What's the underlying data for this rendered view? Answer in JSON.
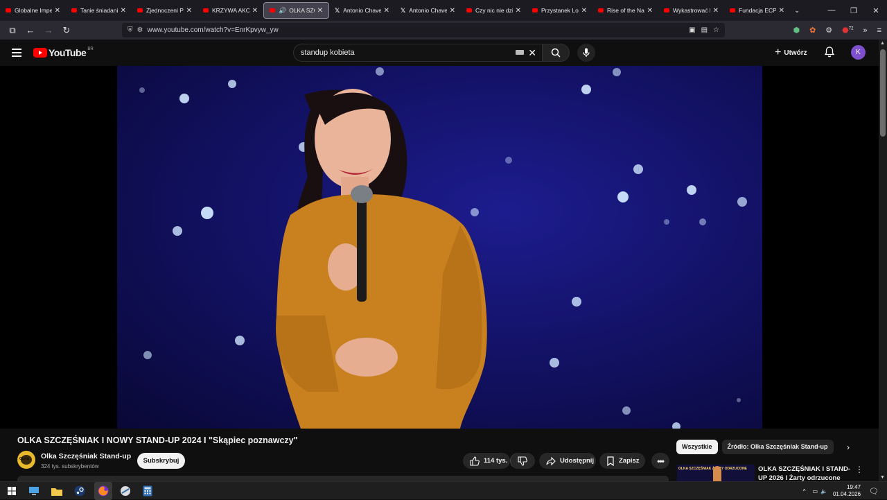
{
  "browser": {
    "tabs": [
      {
        "title": "Globalne Imperi",
        "favicon": "youtube",
        "active": false
      },
      {
        "title": "Tanie śniadanie",
        "favicon": "youtube",
        "active": false
      },
      {
        "title": "Zjednoczeni Prz",
        "favicon": "youtube",
        "active": false
      },
      {
        "title": "KRZYWA AKCJA",
        "favicon": "youtube",
        "active": false
      },
      {
        "title": "OLKA SZCZ",
        "favicon": "youtube",
        "active": true
      },
      {
        "title": "Antonio Chavez",
        "favicon": "x",
        "active": false
      },
      {
        "title": "Antonio Chavez",
        "favicon": "x",
        "active": false
      },
      {
        "title": "Czy nic nie dziej",
        "favicon": "youtube",
        "active": false
      },
      {
        "title": "Przystanek Lom",
        "favicon": "youtube",
        "active": false
      },
      {
        "title": "Rise of the Nazi",
        "favicon": "youtube",
        "active": false
      },
      {
        "title": "Wykastrować b",
        "favicon": "youtube",
        "active": false
      },
      {
        "title": "Fundacja ECPU",
        "favicon": "youtube",
        "active": false
      }
    ],
    "url": "www.youtube.com/watch?v=EnrKpvyw_yw",
    "ext_badge": "72"
  },
  "youtube": {
    "logo_text": "YouTube",
    "country_code": "BR",
    "search_value": "standup kobieta",
    "create_label": "Utwórz",
    "avatar_letter": "K"
  },
  "video": {
    "title": "OLKA SZCZĘŚNIAK I NOWY STAND-UP 2024 I \"Skąpiec poznawczy\"",
    "channel_name": "Olka Szczęśniak Stand-up",
    "channel_avatar_text": "OLKA",
    "subscribers": "324 tys. subskrybentów",
    "subscribe_label": "Subskrybuj",
    "likes": "114 tys.",
    "share_label": "Udostępnij",
    "save_label": "Zapisz"
  },
  "sidebar": {
    "chips": [
      "Wszystkie",
      "Źródło: Olka Szczęśniak Stand-up"
    ],
    "recommendation": {
      "title": "OLKA SZCZĘŚNIAK I STAND-UP 2026 I Żarty odrzucone",
      "thumb_text": "OLKA SZCZĘŚNIAK  ŻARTY ODRZUCONE"
    }
  },
  "taskbar": {
    "time": "19:47",
    "date": "01.04.2026"
  },
  "colors": {
    "youtube_red": "#ff0000",
    "page_bg": "#0f0f0f",
    "avatar": "#7e4fcf",
    "stage_blue": "#1d1c8f",
    "dress_orange": "#c9801f"
  }
}
